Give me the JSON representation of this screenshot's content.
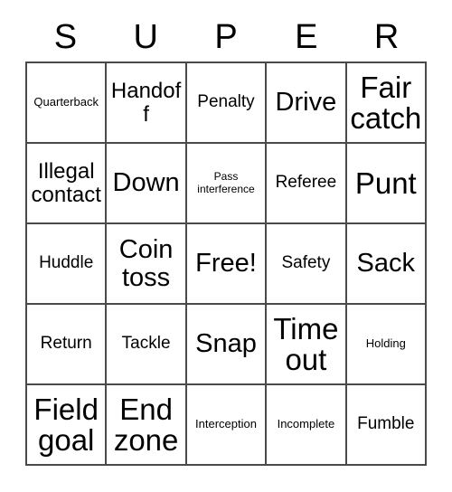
{
  "header": {
    "letters": [
      "S",
      "U",
      "P",
      "E",
      "R"
    ]
  },
  "grid": {
    "columns": 5,
    "rows": 5,
    "border_color": "#4a4a4a",
    "background_color": "#ffffff",
    "text_color": "#000000",
    "cells": [
      {
        "label": "Quarterback",
        "size": "fs-sm"
      },
      {
        "label": "Handoff",
        "size": "fs-lg"
      },
      {
        "label": "Penalty",
        "size": "fs-md"
      },
      {
        "label": "Drive",
        "size": "fs-xl"
      },
      {
        "label": "Fair catch",
        "size": "fs-xxl"
      },
      {
        "label": "Illegal contact",
        "size": "fs-lg"
      },
      {
        "label": "Down",
        "size": "fs-xl"
      },
      {
        "label": "Pass interference",
        "size": "fs-xs"
      },
      {
        "label": "Referee",
        "size": "fs-md"
      },
      {
        "label": "Punt",
        "size": "fs-xxl"
      },
      {
        "label": "Huddle",
        "size": "fs-md"
      },
      {
        "label": "Coin toss",
        "size": "fs-xl"
      },
      {
        "label": "Free!",
        "size": "fs-xl"
      },
      {
        "label": "Safety",
        "size": "fs-md"
      },
      {
        "label": "Sack",
        "size": "fs-xl"
      },
      {
        "label": "Return",
        "size": "fs-md"
      },
      {
        "label": "Tackle",
        "size": "fs-md"
      },
      {
        "label": "Snap",
        "size": "fs-xl"
      },
      {
        "label": "Time out",
        "size": "fs-xxl"
      },
      {
        "label": "Holding",
        "size": "fs-sm"
      },
      {
        "label": "Field goal",
        "size": "fs-xxl"
      },
      {
        "label": "End zone",
        "size": "fs-xxl"
      },
      {
        "label": "Interception",
        "size": "fs-sm"
      },
      {
        "label": "Incomplete",
        "size": "fs-sm"
      },
      {
        "label": "Fumble",
        "size": "fs-md"
      }
    ]
  }
}
